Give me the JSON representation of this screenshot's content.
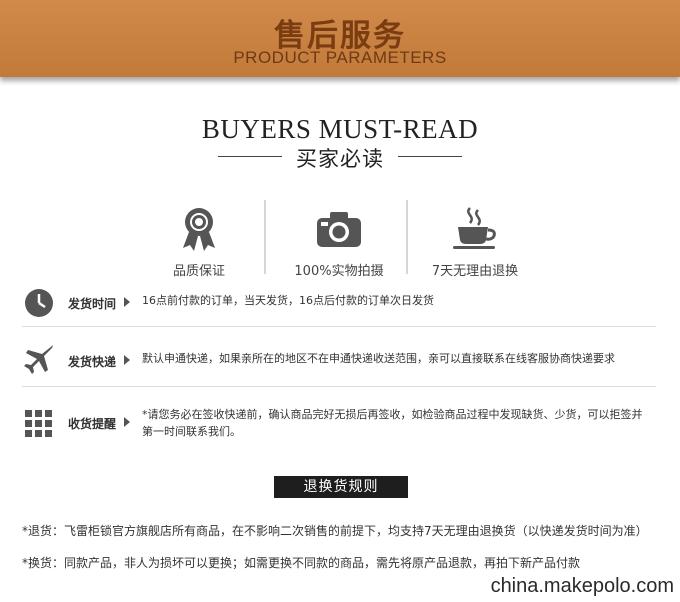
{
  "banner": {
    "title_cn": "售后服务",
    "title_en": "PRODUCT PARAMETERS"
  },
  "header": {
    "title_en": "BUYERS MUST-READ",
    "title_cn": "买家必读"
  },
  "features": [
    {
      "icon": "award-ribbon-icon",
      "label": "品质保证"
    },
    {
      "icon": "camera-icon",
      "label": "100%实物拍摄"
    },
    {
      "icon": "coffee-cup-icon",
      "label": "7天无理由退换"
    }
  ],
  "info_rows": [
    {
      "icon": "clock-icon",
      "label": "发货时间",
      "text": "16点前付款的订单，当天发货，16点后付款的订单次日发货"
    },
    {
      "icon": "airplane-icon",
      "label": "发货快递",
      "text": "默认申通快递，如果亲所在的地区不在申通快递收送范围，亲可以直接联系在线客服协商快递要求"
    },
    {
      "icon": "grid-icon",
      "label": "收货提醒",
      "text": "*请您务必在签收快递前，确认商品完好无损后再签收，如检验商品过程中发现缺货、少货，可以拒签并第一时间联系我们。"
    }
  ],
  "rules": {
    "title": "退换货规则",
    "items": [
      "*退货：飞雷柜锁官方旗舰店所有商品，在不影响二次销售的前提下，均支持7天无理由退换货（以快递发货时间为准）",
      "*换货：同款产品，非人为损坏可以更换；如需更换不同款的商品，需先将原产品退款，再拍下新产品付款"
    ]
  },
  "watermark": "china.makepolo.com",
  "colors": {
    "banner": "#c98240",
    "banner_text": "#7a3d12",
    "icon": "#555555"
  }
}
